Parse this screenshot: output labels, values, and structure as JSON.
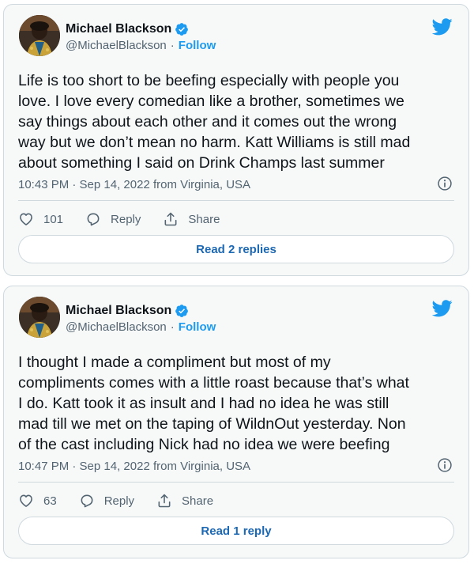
{
  "colors": {
    "accent": "#1d9bf0",
    "text": "#0f1419",
    "muted": "#536471",
    "border": "#cfd9de"
  },
  "tweets": [
    {
      "author_name": "Michael Blackson",
      "handle": "@MichaelBlackson",
      "separator": "·",
      "follow_label": "Follow",
      "text": "Life is too short to be beefing especially with people you\nlove. I love every comedian like a brother, sometimes we\nsay things about each other and it comes out the wrong\nway but we don’t mean no harm. Katt Williams is still mad\nabout something I said on Drink Champs  last summer",
      "timestamp": "10:43 PM · Sep 14, 2022 from Virginia, USA",
      "likes": "101",
      "reply_label": "Reply",
      "share_label": "Share",
      "read_replies_label": "Read 2 replies",
      "icons": [
        "verified-badge-icon",
        "twitter-bird-icon",
        "info-icon",
        "heart-icon",
        "reply-bubble-icon",
        "share-icon"
      ]
    },
    {
      "author_name": "Michael Blackson",
      "handle": "@MichaelBlackson",
      "separator": "·",
      "follow_label": "Follow",
      "text": "I thought I made a compliment but most of my\ncompliments comes with a little roast because that’s what\nI do. Katt took it as insult and I had no idea he was still\nmad till we met on the taping of WildnOut yesterday. Non\nof the cast including Nick had no idea we were beefing",
      "timestamp": "10:47 PM · Sep 14, 2022 from Virginia, USA",
      "likes": "63",
      "reply_label": "Reply",
      "share_label": "Share",
      "read_replies_label": "Read 1 reply",
      "icons": [
        "verified-badge-icon",
        "twitter-bird-icon",
        "info-icon",
        "heart-icon",
        "reply-bubble-icon",
        "share-icon"
      ]
    }
  ]
}
